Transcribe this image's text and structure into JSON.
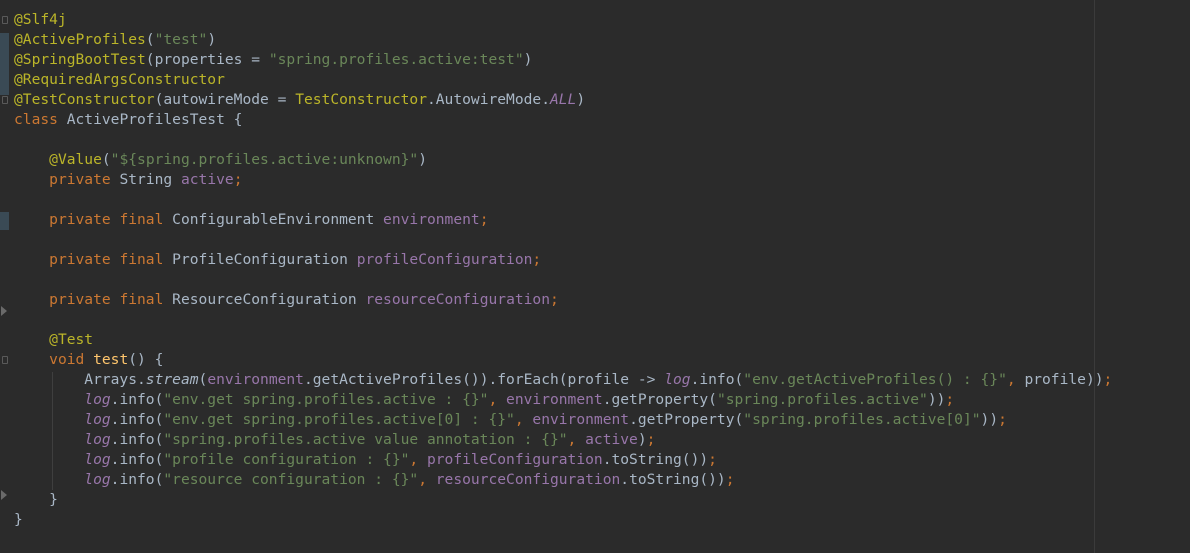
{
  "editor": {
    "language": "java",
    "colors": {
      "background": "#2b2b2b",
      "text": "#a9b7c6",
      "keyword": "#cc7832",
      "annotation": "#bbb529",
      "string": "#6a8759",
      "field": "#9876aa",
      "method_decl": "#ffc66d"
    },
    "lines": [
      [
        {
          "t": "@Slf4j",
          "c": "ann"
        }
      ],
      [
        {
          "t": "@ActiveProfiles",
          "c": "ann"
        },
        {
          "t": "(",
          "c": "plain"
        },
        {
          "t": "\"test\"",
          "c": "str"
        },
        {
          "t": ")",
          "c": "plain"
        }
      ],
      [
        {
          "t": "@SpringBootTest",
          "c": "ann"
        },
        {
          "t": "(properties = ",
          "c": "plain"
        },
        {
          "t": "\"spring.profiles.active:test\"",
          "c": "str"
        },
        {
          "t": ")",
          "c": "plain"
        }
      ],
      [
        {
          "t": "@RequiredArgsConstructor",
          "c": "ann"
        }
      ],
      [
        {
          "t": "@TestConstructor",
          "c": "ann"
        },
        {
          "t": "(autowireMode = ",
          "c": "plain"
        },
        {
          "t": "TestConstructor",
          "c": "ann"
        },
        {
          "t": ".AutowireMode.",
          "c": "plain"
        },
        {
          "t": "ALL",
          "c": "sfld"
        },
        {
          "t": ")",
          "c": "plain"
        }
      ],
      [
        {
          "t": "class",
          "c": "kw"
        },
        {
          "t": " ActiveProfilesTest {",
          "c": "plain"
        }
      ],
      [],
      [
        {
          "t": "    ",
          "c": "plain"
        },
        {
          "t": "@Value",
          "c": "ann"
        },
        {
          "t": "(",
          "c": "plain"
        },
        {
          "t": "\"${spring.profiles.active:unknown}\"",
          "c": "str"
        },
        {
          "t": ")",
          "c": "plain"
        }
      ],
      [
        {
          "t": "    ",
          "c": "plain"
        },
        {
          "t": "private",
          "c": "kw"
        },
        {
          "t": " String ",
          "c": "plain"
        },
        {
          "t": "active",
          "c": "fld"
        },
        {
          "t": ";",
          "c": "kw"
        }
      ],
      [],
      [
        {
          "t": "    ",
          "c": "plain"
        },
        {
          "t": "private final",
          "c": "kw"
        },
        {
          "t": " ConfigurableEnvironment ",
          "c": "plain"
        },
        {
          "t": "environment",
          "c": "fld"
        },
        {
          "t": ";",
          "c": "kw"
        }
      ],
      [],
      [
        {
          "t": "    ",
          "c": "plain"
        },
        {
          "t": "private final",
          "c": "kw"
        },
        {
          "t": " ProfileConfiguration ",
          "c": "plain"
        },
        {
          "t": "profileConfiguration",
          "c": "fld"
        },
        {
          "t": ";",
          "c": "kw"
        }
      ],
      [],
      [
        {
          "t": "    ",
          "c": "plain"
        },
        {
          "t": "private final",
          "c": "kw"
        },
        {
          "t": " ResourceConfiguration ",
          "c": "plain"
        },
        {
          "t": "resourceConfiguration",
          "c": "fld"
        },
        {
          "t": ";",
          "c": "kw"
        }
      ],
      [],
      [
        {
          "t": "    ",
          "c": "plain"
        },
        {
          "t": "@Test",
          "c": "ann"
        }
      ],
      [
        {
          "t": "    ",
          "c": "plain"
        },
        {
          "t": "void",
          "c": "kw"
        },
        {
          "t": " ",
          "c": "plain"
        },
        {
          "t": "test",
          "c": "call"
        },
        {
          "t": "() {",
          "c": "plain"
        }
      ],
      [
        {
          "t": "        Arrays.",
          "c": "plain"
        },
        {
          "t": "stream",
          "c": "smeth"
        },
        {
          "t": "(",
          "c": "plain"
        },
        {
          "t": "environment",
          "c": "fld"
        },
        {
          "t": ".getActiveProfiles()).forEach(profile -> ",
          "c": "plain"
        },
        {
          "t": "log",
          "c": "sfld"
        },
        {
          "t": ".info(",
          "c": "plain"
        },
        {
          "t": "\"env.getActiveProfiles() : {}\"",
          "c": "str"
        },
        {
          "t": ", ",
          "c": "kw"
        },
        {
          "t": "profile))",
          "c": "plain"
        },
        {
          "t": ";",
          "c": "kw"
        }
      ],
      [
        {
          "t": "        ",
          "c": "plain"
        },
        {
          "t": "log",
          "c": "sfld"
        },
        {
          "t": ".info(",
          "c": "plain"
        },
        {
          "t": "\"env.get spring.profiles.active : {}\"",
          "c": "str"
        },
        {
          "t": ", ",
          "c": "kw"
        },
        {
          "t": "environment",
          "c": "fld"
        },
        {
          "t": ".getProperty(",
          "c": "plain"
        },
        {
          "t": "\"spring.profiles.active\"",
          "c": "str"
        },
        {
          "t": "))",
          "c": "plain"
        },
        {
          "t": ";",
          "c": "kw"
        }
      ],
      [
        {
          "t": "        ",
          "c": "plain"
        },
        {
          "t": "log",
          "c": "sfld"
        },
        {
          "t": ".info(",
          "c": "plain"
        },
        {
          "t": "\"env.get spring.profiles.active[0] : {}\"",
          "c": "str"
        },
        {
          "t": ", ",
          "c": "kw"
        },
        {
          "t": "environment",
          "c": "fld"
        },
        {
          "t": ".getProperty(",
          "c": "plain"
        },
        {
          "t": "\"spring.profiles.active[0]\"",
          "c": "str"
        },
        {
          "t": "))",
          "c": "plain"
        },
        {
          "t": ";",
          "c": "kw"
        }
      ],
      [
        {
          "t": "        ",
          "c": "plain"
        },
        {
          "t": "log",
          "c": "sfld"
        },
        {
          "t": ".info(",
          "c": "plain"
        },
        {
          "t": "\"spring.profiles.active value annotation : {}\"",
          "c": "str"
        },
        {
          "t": ", ",
          "c": "kw"
        },
        {
          "t": "active",
          "c": "fld"
        },
        {
          "t": ")",
          "c": "plain"
        },
        {
          "t": ";",
          "c": "kw"
        }
      ],
      [
        {
          "t": "        ",
          "c": "plain"
        },
        {
          "t": "log",
          "c": "sfld"
        },
        {
          "t": ".info(",
          "c": "plain"
        },
        {
          "t": "\"profile configuration : {}\"",
          "c": "str"
        },
        {
          "t": ", ",
          "c": "kw"
        },
        {
          "t": "profileConfiguration",
          "c": "fld"
        },
        {
          "t": ".toString())",
          "c": "plain"
        },
        {
          "t": ";",
          "c": "kw"
        }
      ],
      [
        {
          "t": "        ",
          "c": "plain"
        },
        {
          "t": "log",
          "c": "sfld"
        },
        {
          "t": ".info(",
          "c": "plain"
        },
        {
          "t": "\"resource configuration : {}\"",
          "c": "str"
        },
        {
          "t": ", ",
          "c": "kw"
        },
        {
          "t": "resourceConfiguration",
          "c": "fld"
        },
        {
          "t": ".toString())",
          "c": "plain"
        },
        {
          "t": ";",
          "c": "kw"
        }
      ],
      [
        {
          "t": "    }",
          "c": "plain"
        }
      ],
      [
        {
          "t": "}",
          "c": "plain"
        }
      ]
    ]
  }
}
